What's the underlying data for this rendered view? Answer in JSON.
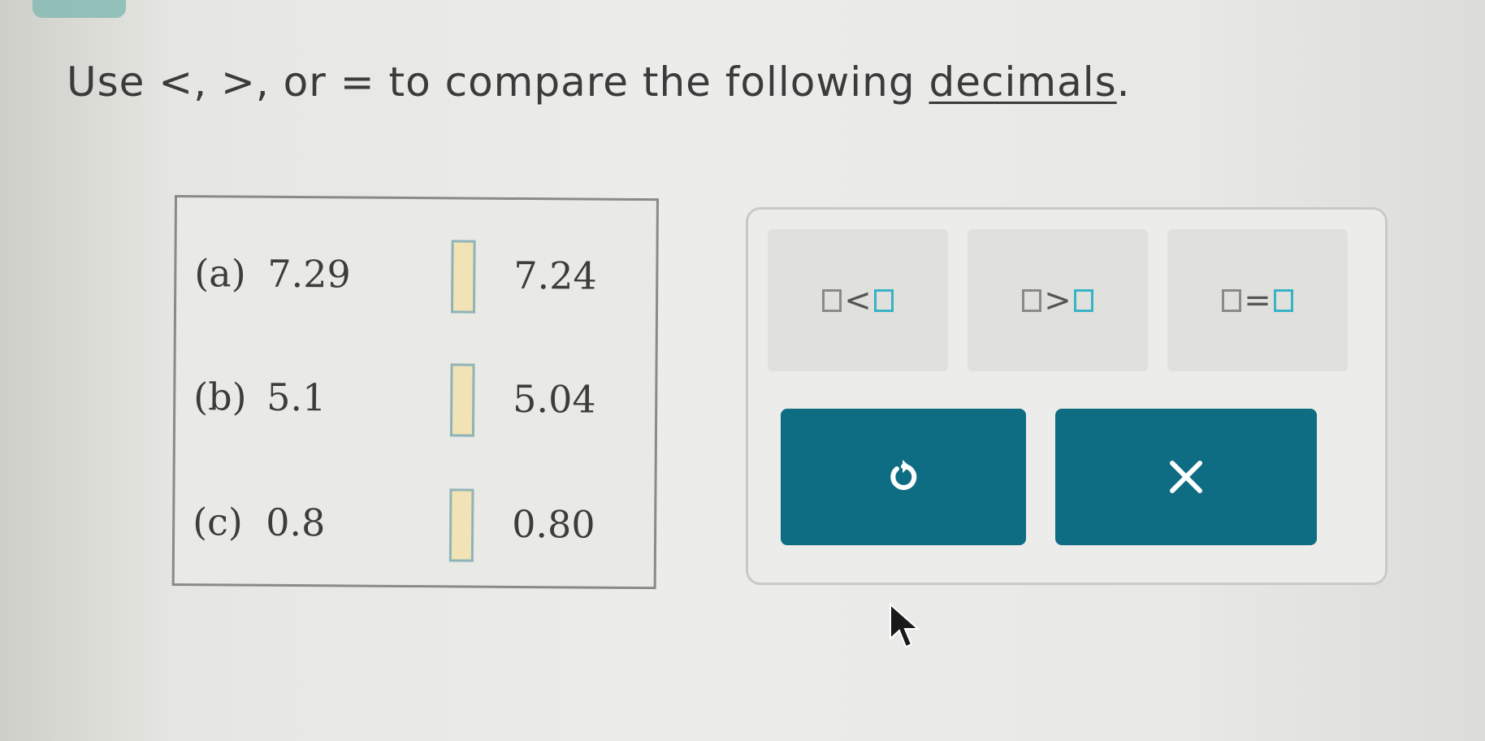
{
  "instruction": {
    "prefix": "Use <, >, or = to compare the following ",
    "link": "decimals",
    "suffix": "."
  },
  "problems": [
    {
      "label": "(a)",
      "left": "7.29",
      "right": "7.24"
    },
    {
      "label": "(b)",
      "left": "5.1",
      "right": "5.04"
    },
    {
      "label": "(c)",
      "left": "0.8",
      "right": "0.80"
    }
  ],
  "symbols": [
    {
      "op": "<",
      "name": "less-than"
    },
    {
      "op": ">",
      "name": "greater-than"
    },
    {
      "op": "=",
      "name": "equals"
    }
  ],
  "actions": {
    "undo_icon": "undo-icon",
    "clear_icon": "close-icon"
  },
  "colors": {
    "action_button": "#0e6d82",
    "answer_slot": "#f1e3b6",
    "accent_teal": "#38b3c5"
  }
}
